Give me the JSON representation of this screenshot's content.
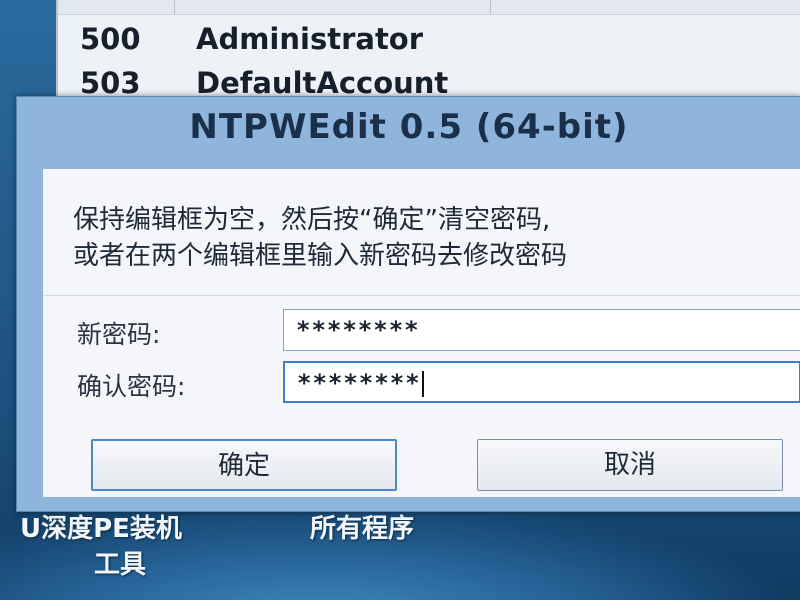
{
  "user_list": {
    "rows": [
      {
        "rid": "500",
        "name": "Administrator"
      },
      {
        "rid": "503",
        "name": "DefaultAccount"
      }
    ]
  },
  "dialog": {
    "title": "NTPWEdit 0.5 (64-bit)",
    "message_line1": "保持编辑框为空，然后按“确定”清空密码,",
    "message_line2": "或者在两个编辑框里输入新密码去修改密码",
    "new_password_label": "新密码:",
    "new_password_value": "********",
    "confirm_password_label": "确认密码:",
    "confirm_password_value": "********",
    "ok_label": "确定",
    "cancel_label": "取消"
  },
  "desktop": {
    "icon1_label_line1": "U深度PE装机",
    "icon1_label_line2": "工具",
    "icon2_label": "所有程序"
  }
}
